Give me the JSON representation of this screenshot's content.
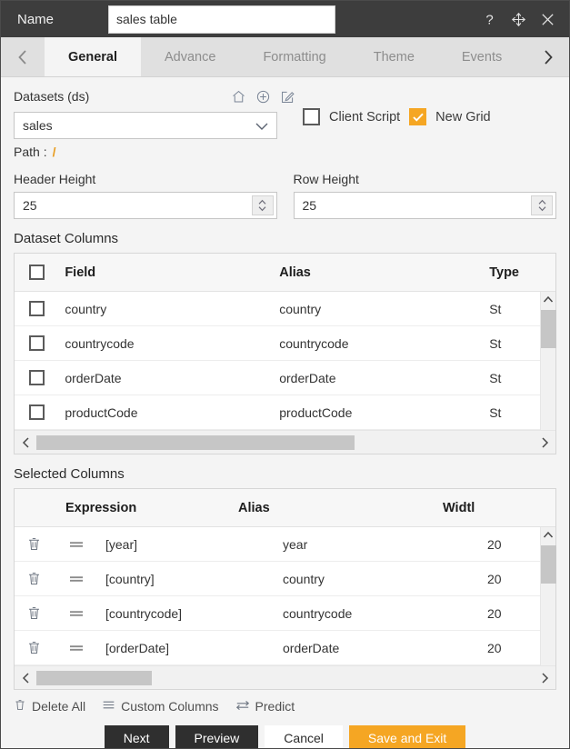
{
  "titlebar": {
    "name_label": "Name",
    "name_value": "sales table",
    "name_placeholder": "",
    "help_icon": "question-mark-icon",
    "move_icon": "move-icon",
    "close_icon": "close-icon"
  },
  "tabbar": {
    "prev_arrow": "chevron-left-icon",
    "next_arrow": "chevron-right-icon",
    "tabs": [
      {
        "label": "General",
        "active": true
      },
      {
        "label": "Advance",
        "active": false
      },
      {
        "label": "Formatting",
        "active": false
      },
      {
        "label": "Theme",
        "active": false
      },
      {
        "label": "Events",
        "active": false
      }
    ]
  },
  "datasets": {
    "label": "Datasets (ds)",
    "icons": [
      "home-icon",
      "plus-circle-icon",
      "edit-square-icon"
    ],
    "selected": "sales",
    "path_label": "Path :",
    "path_value": "/"
  },
  "options": {
    "client_script": {
      "label": "Client Script",
      "checked": false
    },
    "new_grid": {
      "label": "New Grid",
      "checked": true,
      "check_color": "#f5a623"
    }
  },
  "sizes": {
    "header_height_label": "Header Height",
    "header_height_value": "25",
    "row_height_label": "Row Height",
    "row_height_value": "25"
  },
  "dataset_columns": {
    "title": "Dataset Columns",
    "headers": {
      "field": "Field",
      "alias": "Alias",
      "type": "Type"
    },
    "select_all_checked": false,
    "rows": [
      {
        "checked": false,
        "field": "country",
        "alias": "country",
        "type": "St"
      },
      {
        "checked": false,
        "field": "countrycode",
        "alias": "countrycode",
        "type": "St"
      },
      {
        "checked": false,
        "field": "orderDate",
        "alias": "orderDate",
        "type": "St"
      },
      {
        "checked": false,
        "field": "productCode",
        "alias": "productCode",
        "type": "St"
      }
    ]
  },
  "selected_columns": {
    "title": "Selected Columns",
    "headers": {
      "expression": "Expression",
      "alias": "Alias",
      "width": "Widtl"
    },
    "rows": [
      {
        "delete_icon": "trash-icon",
        "drag_icon": "drag-handle-icon",
        "expression": "[year]",
        "alias": "year",
        "width": "20"
      },
      {
        "delete_icon": "trash-icon",
        "drag_icon": "drag-handle-icon",
        "expression": "[country]",
        "alias": "country",
        "width": "20"
      },
      {
        "delete_icon": "trash-icon",
        "drag_icon": "drag-handle-icon",
        "expression": "[countrycode]",
        "alias": "countrycode",
        "width": "20"
      },
      {
        "delete_icon": "trash-icon",
        "drag_icon": "drag-handle-icon",
        "expression": "[orderDate]",
        "alias": "orderDate",
        "width": "20"
      }
    ]
  },
  "toolbar_links": [
    {
      "label": "Delete All",
      "icon": "trash-icon"
    },
    {
      "label": "Custom Columns",
      "icon": "list-icon"
    },
    {
      "label": "Predict",
      "icon": "swap-arrows-icon"
    }
  ],
  "buttons": {
    "next": "Next",
    "preview": "Preview",
    "cancel": "Cancel",
    "save_and_exit": "Save and Exit"
  }
}
